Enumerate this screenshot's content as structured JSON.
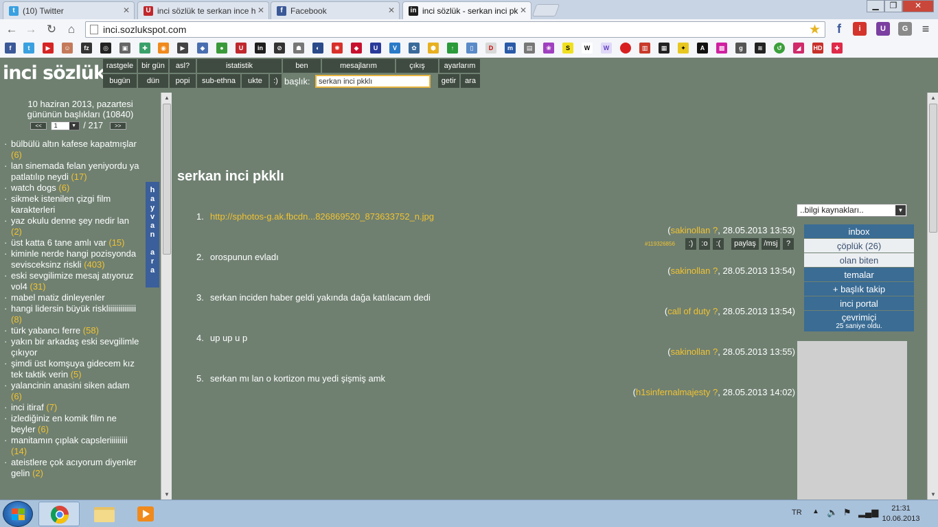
{
  "browser": {
    "tabs": [
      {
        "label": "(10) Twitter",
        "favicon": "twitter-icon",
        "color": "#3aa1e0"
      },
      {
        "label": "inci sözlük te serkan ince h",
        "favicon": "uludag-icon",
        "color": "#c0282d"
      },
      {
        "label": "Facebook",
        "favicon": "facebook-icon",
        "color": "#3b5998"
      },
      {
        "label": "inci sözlük - serkan inci pk",
        "favicon": "inci-icon",
        "color": "#1e1e1e"
      }
    ],
    "url": "inci.sozlukspot.com",
    "window_controls": {
      "minimize": "▁",
      "maximize": "❐",
      "close": "✕"
    }
  },
  "site": {
    "logo": "inci sözlük",
    "nav_top": [
      "rastgele",
      "bir gün",
      "asl?",
      "istatistik",
      "ben",
      "mesajlarım",
      "çıkış",
      "ayarlarım"
    ],
    "nav_bottom": [
      "bugün",
      "dün",
      "popi",
      "sub-ethna",
      "ukte",
      ":)"
    ],
    "search": {
      "label": "başlık:",
      "value": "serkan inci pkklı",
      "go_label": "getir",
      "search_label": "ara"
    }
  },
  "left": {
    "date_line1": "10 haziran 2013, pazartesi",
    "date_line2": "gününün başlıkları (10840)",
    "pager": {
      "prev": "<<",
      "page": "1",
      "total": "/ 217",
      "next": ">>"
    },
    "side_tab": [
      "h",
      "a",
      "y",
      "v",
      "a",
      "n",
      "",
      "a",
      "r",
      "a"
    ],
    "topics": [
      {
        "title": "bülbülü altın kafese kapatmışlar",
        "count": "(6)"
      },
      {
        "title": "lan sinemada felan yeniyordu ya patlatılıp neydi",
        "count": "(17)"
      },
      {
        "title": "watch dogs",
        "count": "(6)"
      },
      {
        "title": "sikmek istenilen çizgi film karakterleri",
        "count": ""
      },
      {
        "title": "yaz okulu denne şey nedir lan",
        "count": "(2)"
      },
      {
        "title": "üst katta 6 tane amlı var",
        "count": "(15)"
      },
      {
        "title": "kiminle nerde hangi pozisyonda sevisceksinz riskli",
        "count": "(403)"
      },
      {
        "title": "eski sevgilimize mesaj atıyoruz vol4",
        "count": "(31)"
      },
      {
        "title": "mabel matiz dinleyenler",
        "count": ""
      },
      {
        "title": "hangi lidersin büyük riskliiiiiiiiiiiiii",
        "count": "(8)"
      },
      {
        "title": "türk yabancı ferre",
        "count": "(58)"
      },
      {
        "title": "yakın bir arkadaş eski sevgilimle çıkıyor",
        "count": ""
      },
      {
        "title": "şimdi üst komşuya gidecem kız tek taktik verin",
        "count": "(5)"
      },
      {
        "title": "yalancinin anasini siken adam",
        "count": "(6)"
      },
      {
        "title": "inci itiraf",
        "count": "(7)"
      },
      {
        "title": "izlediğiniz en komik film ne beyler",
        "count": "(6)"
      },
      {
        "title": "manitamın çıplak capsleriiiiiiiii",
        "count": "(14)"
      },
      {
        "title": "ateistlere çok acıyorum diyenler gelin",
        "count": "(2)"
      }
    ]
  },
  "main": {
    "title": "serkan inci pkklı",
    "entries": [
      {
        "num": "1.",
        "text": "http://sphotos-g.ak.fbcdn...826869520_873633752_n.jpg",
        "link": true,
        "author": "sakinollan ?",
        "date": ", 28.05.2013 13:53)"
      },
      {
        "num": "2.",
        "text": "orospunun evladı",
        "link": false,
        "author": "sakinollan ?",
        "date": ", 28.05.2013 13:54)"
      },
      {
        "num": "3.",
        "text": "serkan inciden haber geldi yakında dağa katılacam dedi",
        "link": false,
        "author": "call of duty ?",
        "date": ", 28.05.2013 13:54)"
      },
      {
        "num": "4.",
        "text": "up up u p",
        "link": false,
        "author": "sakinollan ?",
        "date": ", 28.05.2013 13:55)"
      },
      {
        "num": "5.",
        "text": "serkan mı lan o kortizon mu yedi şişmiş amk",
        "link": false,
        "author": "h1sinfernalmajesty ?",
        "date": ", 28.05.2013 14:02)"
      }
    ],
    "entry_tools": {
      "id": "#119326856",
      "buttons": [
        ":)",
        ":o",
        ":(",
        "paylaş",
        "/msj",
        "?"
      ]
    }
  },
  "right": {
    "source_select": "..bilgi kaynakları..",
    "menu": [
      {
        "label": "inbox",
        "light": false
      },
      {
        "label": "çöplük (26)",
        "light": true
      },
      {
        "label": "olan biten",
        "light": true
      },
      {
        "label": "temalar",
        "light": false
      },
      {
        "label": "+ başlık takip",
        "light": false
      },
      {
        "label": "inci portal",
        "light": false
      }
    ],
    "online": {
      "label": "çevrimiçi",
      "sub": "25 saniye oldu."
    }
  },
  "taskbar": {
    "lang": "TR",
    "time": "21:31",
    "date": "10.06.2013"
  }
}
